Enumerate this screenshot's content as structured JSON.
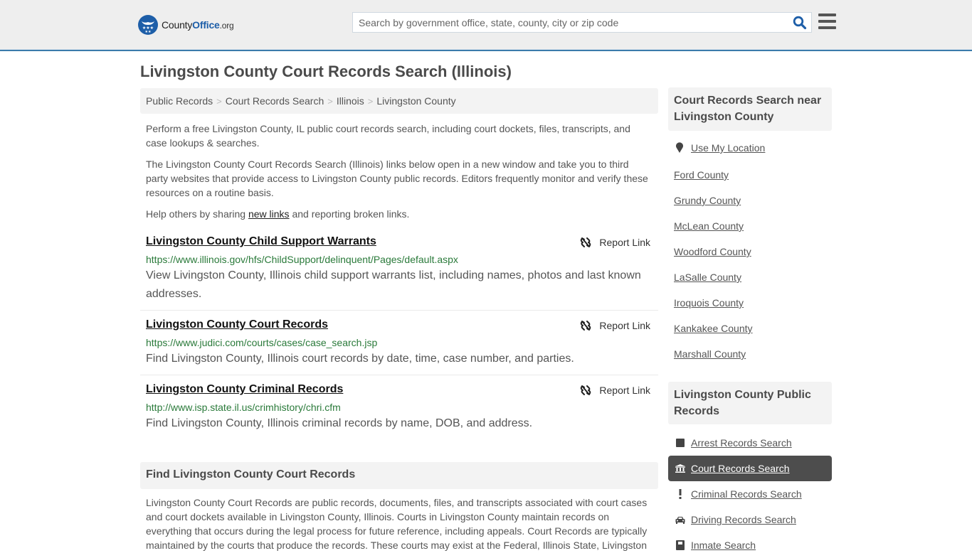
{
  "header": {
    "logo": {
      "county": "County",
      "office": "Office",
      "tld": ".org"
    },
    "search": {
      "placeholder": "Search by government office, state, county, city or zip code",
      "value": ""
    },
    "colors": {
      "brand": "#1d5ea8",
      "accent_border": "#3b7bab"
    }
  },
  "main": {
    "title": "Livingston County Court Records Search (Illinois)",
    "breadcrumb": [
      "Public Records",
      "Court Records Search",
      "Illinois",
      "Livingston County"
    ],
    "breadcrumb_sep": ">",
    "intro": {
      "p1": "Perform a free Livingston County, IL public court records search, including court dockets, files, transcripts, and case lookups & searches.",
      "p2": "The Livingston County Court Records Search (Illinois) links below open in a new window and take you to third party websites that provide access to Livingston County public records. Editors frequently monitor and verify these resources on a routine basis.",
      "p3_before": "Help others by sharing ",
      "p3_link": "new links",
      "p3_after": " and reporting broken links."
    },
    "report_label": "Report Link",
    "results": [
      {
        "title": "Livingston County Child Support Warrants",
        "url": "https://www.illinois.gov/hfs/ChildSupport/delinquent/Pages/default.aspx",
        "description": "View Livingston County, Illinois child support warrants list, including names, photos and last known addresses."
      },
      {
        "title": "Livingston County Court Records",
        "url": "https://www.judici.com/courts/cases/case_search.jsp",
        "description": "Find Livingston County, Illinois court records by date, time, case number, and parties."
      },
      {
        "title": "Livingston County Criminal Records",
        "url": "http://www.isp.state.il.us/crimhistory/chri.cfm",
        "description": "Find Livingston County, Illinois criminal records by name, DOB, and address."
      }
    ],
    "section": {
      "heading": "Find Livingston County Court Records",
      "body": "Livingston County Court Records are public records, documents, files, and transcripts associated with court cases and court dockets available in Livingston County, Illinois. Courts in Livingston County maintain records on everything that occurs during the legal process for future reference, including appeals. Court Records are typically maintained by the courts that produce the records. These courts may exist at the Federal, Illinois State, Livingston"
    }
  },
  "sidebar": {
    "nearby": {
      "heading": "Court Records Search near Livingston County",
      "use_location": "Use My Location",
      "counties": [
        "Ford County",
        "Grundy County",
        "McLean County",
        "Woodford County",
        "LaSalle County",
        "Iroquois County",
        "Kankakee County",
        "Marshall County"
      ]
    },
    "public_records": {
      "heading": "Livingston County Public Records",
      "items": [
        {
          "label": "Arrest Records Search",
          "icon": "square-icon",
          "active": false
        },
        {
          "label": "Court Records Search",
          "icon": "courthouse-icon",
          "active": true
        },
        {
          "label": "Criminal Records Search",
          "icon": "exclamation-icon",
          "active": false
        },
        {
          "label": "Driving Records Search",
          "icon": "car-icon",
          "active": false
        },
        {
          "label": "Inmate Search",
          "icon": "inmate-icon",
          "active": false
        }
      ]
    }
  }
}
